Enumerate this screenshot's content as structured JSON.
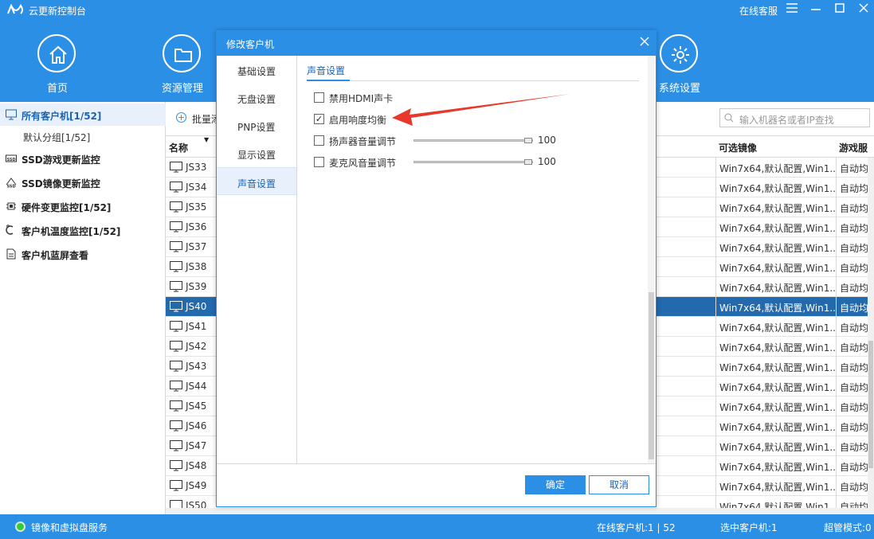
{
  "titlebar": {
    "app_title": "云更新控制台",
    "online_service": "在线客服",
    "menu_icon": "menu-icon",
    "min_icon": "minimize-icon",
    "max_icon": "maximize-icon",
    "close_icon": "close-icon"
  },
  "topnav": {
    "items": [
      {
        "label": "首页",
        "icon": "home-icon"
      },
      {
        "label": "资源管理",
        "icon": "folder-icon"
      },
      {
        "label": "系统设置",
        "icon": "gear-icon"
      }
    ]
  },
  "sidebar": {
    "all_clients": "所有客户机[1/52]",
    "default_group": "默认分组[1/52]",
    "items": [
      {
        "label": "SSD游戏更新监控",
        "icon": "ssd-game-icon"
      },
      {
        "label": "SSD镜像更新监控",
        "icon": "ssd-image-icon"
      },
      {
        "label": "硬件变更监控[1/52]",
        "icon": "chip-icon"
      },
      {
        "label": "客户机温度监控[1/52]",
        "icon": "thermometer-icon"
      },
      {
        "label": "客户机蓝屏查看",
        "icon": "document-icon"
      }
    ]
  },
  "toolbar": {
    "batch_add": "批量添",
    "search_placeholder": "输入机器名或者IP查找"
  },
  "table": {
    "headers": {
      "name": "名称",
      "image": "可选镜像",
      "service": "游戏服"
    },
    "rows": [
      {
        "name": "JS33",
        "image": "Win7x64,默认配置,Win1...",
        "service": "自动均"
      },
      {
        "name": "JS34",
        "image": "Win7x64,默认配置,Win1...",
        "service": "自动均"
      },
      {
        "name": "JS35",
        "image": "Win7x64,默认配置,Win1...",
        "service": "自动均"
      },
      {
        "name": "JS36",
        "image": "Win7x64,默认配置,Win1...",
        "service": "自动均"
      },
      {
        "name": "JS37",
        "image": "Win7x64,默认配置,Win1...",
        "service": "自动均"
      },
      {
        "name": "JS38",
        "image": "Win7x64,默认配置,Win1...",
        "service": "自动均"
      },
      {
        "name": "JS39",
        "image": "Win7x64,默认配置,Win1...",
        "service": "自动均"
      },
      {
        "name": "JS40",
        "image": "Win7x64,默认配置,Win1...",
        "service": "自动均",
        "selected": true
      },
      {
        "name": "JS41",
        "image": "Win7x64,默认配置,Win1...",
        "service": "自动均"
      },
      {
        "name": "JS42",
        "image": "Win7x64,默认配置,Win1...",
        "service": "自动均"
      },
      {
        "name": "JS43",
        "image": "Win7x64,默认配置,Win1...",
        "service": "自动均"
      },
      {
        "name": "JS44",
        "image": "Win7x64,默认配置,Win1...",
        "service": "自动均"
      },
      {
        "name": "JS45",
        "image": "Win7x64,默认配置,Win1...",
        "service": "自动均"
      },
      {
        "name": "JS46",
        "image": "Win7x64,默认配置,Win1...",
        "service": "自动均"
      },
      {
        "name": "JS47",
        "image": "Win7x64,默认配置,Win1...",
        "service": "自动均"
      },
      {
        "name": "JS48",
        "image": "Win7x64,默认配置,Win1...",
        "service": "自动均"
      },
      {
        "name": "JS49",
        "image": "Win7x64,默认配置,Win1...",
        "service": "自动均"
      },
      {
        "name": "JS50",
        "image": "Win7x64,默认配置,Win1...",
        "service": "自动均"
      }
    ]
  },
  "statusbar": {
    "service": "镜像和虚拟盘服务",
    "online_clients": "在线客户机:1 | 52",
    "selected_clients": "选中客户机:1",
    "super_mode": "超管模式:0"
  },
  "dialog": {
    "title": "修改客户机",
    "nav": [
      {
        "label": "基础设置"
      },
      {
        "label": "无盘设置"
      },
      {
        "label": "PNP设置"
      },
      {
        "label": "显示设置"
      },
      {
        "label": "声音设置",
        "active": true
      }
    ],
    "section_title": "声音设置",
    "options": [
      {
        "label": "禁用HDMI声卡",
        "checked": false
      },
      {
        "label": "启用响度均衡",
        "checked": true
      },
      {
        "label": "扬声器音量调节",
        "checked": false,
        "value": "100",
        "level": 1.0
      },
      {
        "label": "麦克风音量调节",
        "checked": false,
        "value": "100",
        "level": 1.0
      }
    ],
    "ok_label": "确定",
    "cancel_label": "取消"
  },
  "colors": {
    "brand_blue": "#2c8fe6",
    "selected_row": "#2269ae",
    "annotation_red": "#e8372b"
  }
}
